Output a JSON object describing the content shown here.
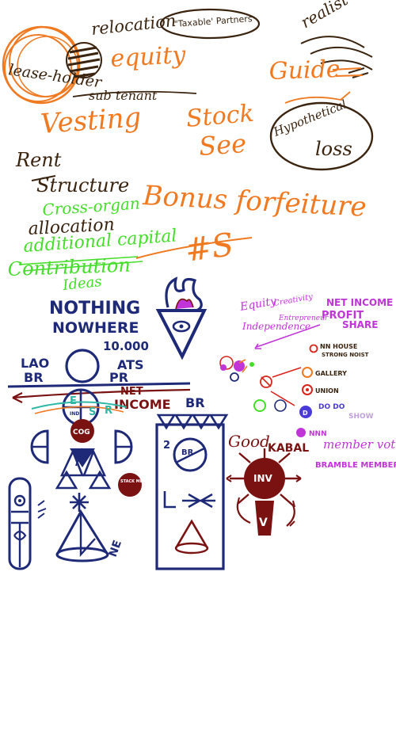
{
  "colors": {
    "brown": "#3a2410",
    "orange": "#f07a22",
    "green": "#44dd2a",
    "navy": "#1e2a78",
    "maroon": "#7a1212",
    "purple": "#c034d8",
    "red": "#d8241c",
    "teal": "#2fb8a6"
  },
  "top": {
    "relocation": "relocation",
    "taxable_partners": "\"Taxable' Partners",
    "realist": "realist",
    "lease_holder": "lease-holder",
    "equity": "equity",
    "sub_tenant": "sub tenant",
    "vesting": "Vesting",
    "stock": "Stock",
    "see": "See",
    "guide": "Guide",
    "hypothetical": "Hypothetical",
    "loss": "loss",
    "rent": "Rent",
    "structure": "Structure",
    "bonus": "Bonus forfeiture",
    "cross": "Cross-organ",
    "allocation": "allocation",
    "additional_capital": "additional capital",
    "contribution": "Contribution",
    "ideas": "Ideas",
    "hash": "#S"
  },
  "center": {
    "nothing": "NOTHING",
    "nowhere": "NOWHERE",
    "ten_thousand": "10.000",
    "lao": "LAO",
    "br": "BR",
    "ats": "ATS",
    "pr": "PR",
    "net": "NET",
    "income": "INCOME",
    "e": "E",
    "s": "S",
    "r": "R",
    "ind": "IND",
    "cog": "COG",
    "stack": "STACK MEME MARKET",
    "ne": "NE"
  },
  "right": {
    "equity": "Equity",
    "creativity": "Creativity",
    "entrepreneur": "Entrepreneur",
    "independence": "Independence",
    "net_income": "NET INCOME",
    "profit": "PROFIT",
    "share": "SHARE",
    "nn_house": "NN HOUSE",
    "strong_noist": "STRONG NOIST",
    "gallery": "GALLERY",
    "union": "UNION",
    "do_do": "DO DO",
    "show": "SHOW",
    "nnn": "NNN",
    "member_vote": "member vote",
    "bramble_member": "BRAMBLE MEMBER",
    "good": "Good",
    "kabal": "KABAL",
    "inv": "INV",
    "v": "V",
    "br": "BR",
    "two": "2",
    "br_circle": "BR"
  }
}
